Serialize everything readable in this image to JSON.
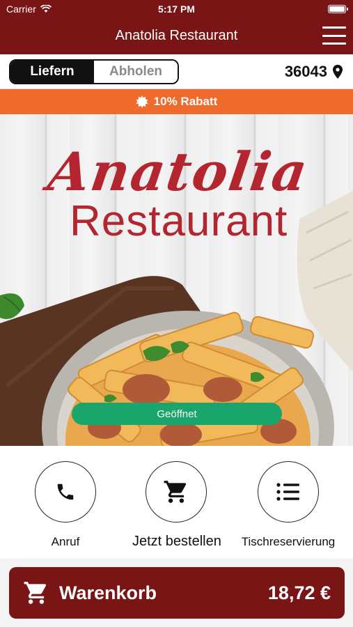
{
  "status_bar": {
    "carrier": "Carrier",
    "time": "5:17 PM"
  },
  "header": {
    "title": "Anatolia Restaurant"
  },
  "mode_toggle": {
    "options": [
      "Liefern",
      "Abholen"
    ],
    "selected": "Liefern"
  },
  "location": {
    "zip": "36043"
  },
  "promo": {
    "text": "10% Rabatt"
  },
  "hero": {
    "brand_script": "Anatolia",
    "brand_sub": "Restaurant",
    "status": "Geöffnet"
  },
  "actions": [
    {
      "label": "Anruf",
      "icon": "phone-icon"
    },
    {
      "label": "Jetzt bestellen",
      "icon": "cart-icon"
    },
    {
      "label": "Tischreservierung",
      "icon": "list-icon"
    }
  ],
  "cart": {
    "label": "Warenkorb",
    "total": "18,72 €"
  },
  "colors": {
    "brand": "#7a1515",
    "promo": "#ee6a2d",
    "open": "#1aa56c",
    "logo": "#b3262f"
  }
}
